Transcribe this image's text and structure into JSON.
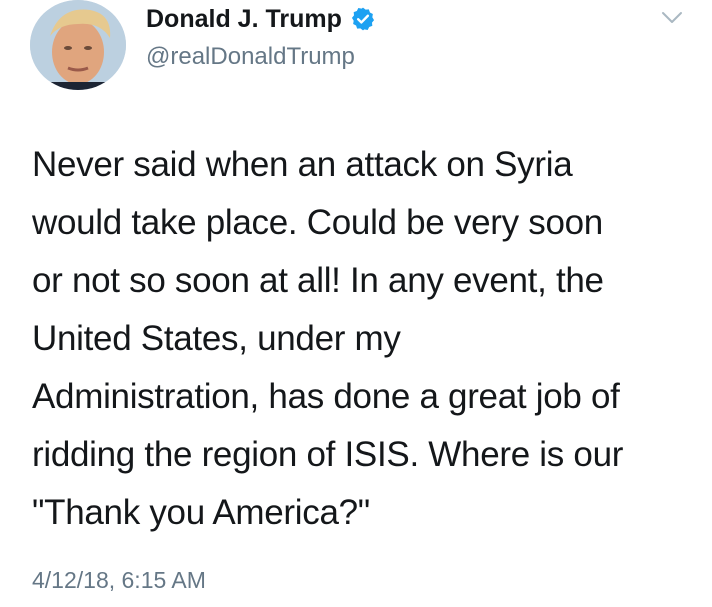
{
  "tweet": {
    "author": {
      "display_name": "Donald J. Trump",
      "handle": "@realDonaldTrump",
      "verified": true,
      "avatar_icon": "profile-photo"
    },
    "text": "Never said when an attack on Syria\nwould take place. Could be very soon\nor not so soon at all! In any event, the\nUnited States, under my\nAdministration, has done a great job of\nridding the region of ISIS. Where is our\n\"Thank you America?\"",
    "timestamp": "4/12/18, 6:15 AM",
    "menu_icon": "chevron-down-icon",
    "colors": {
      "text": "#14171a",
      "secondary": "#657786",
      "verified_badge": "#1da1f2"
    }
  }
}
